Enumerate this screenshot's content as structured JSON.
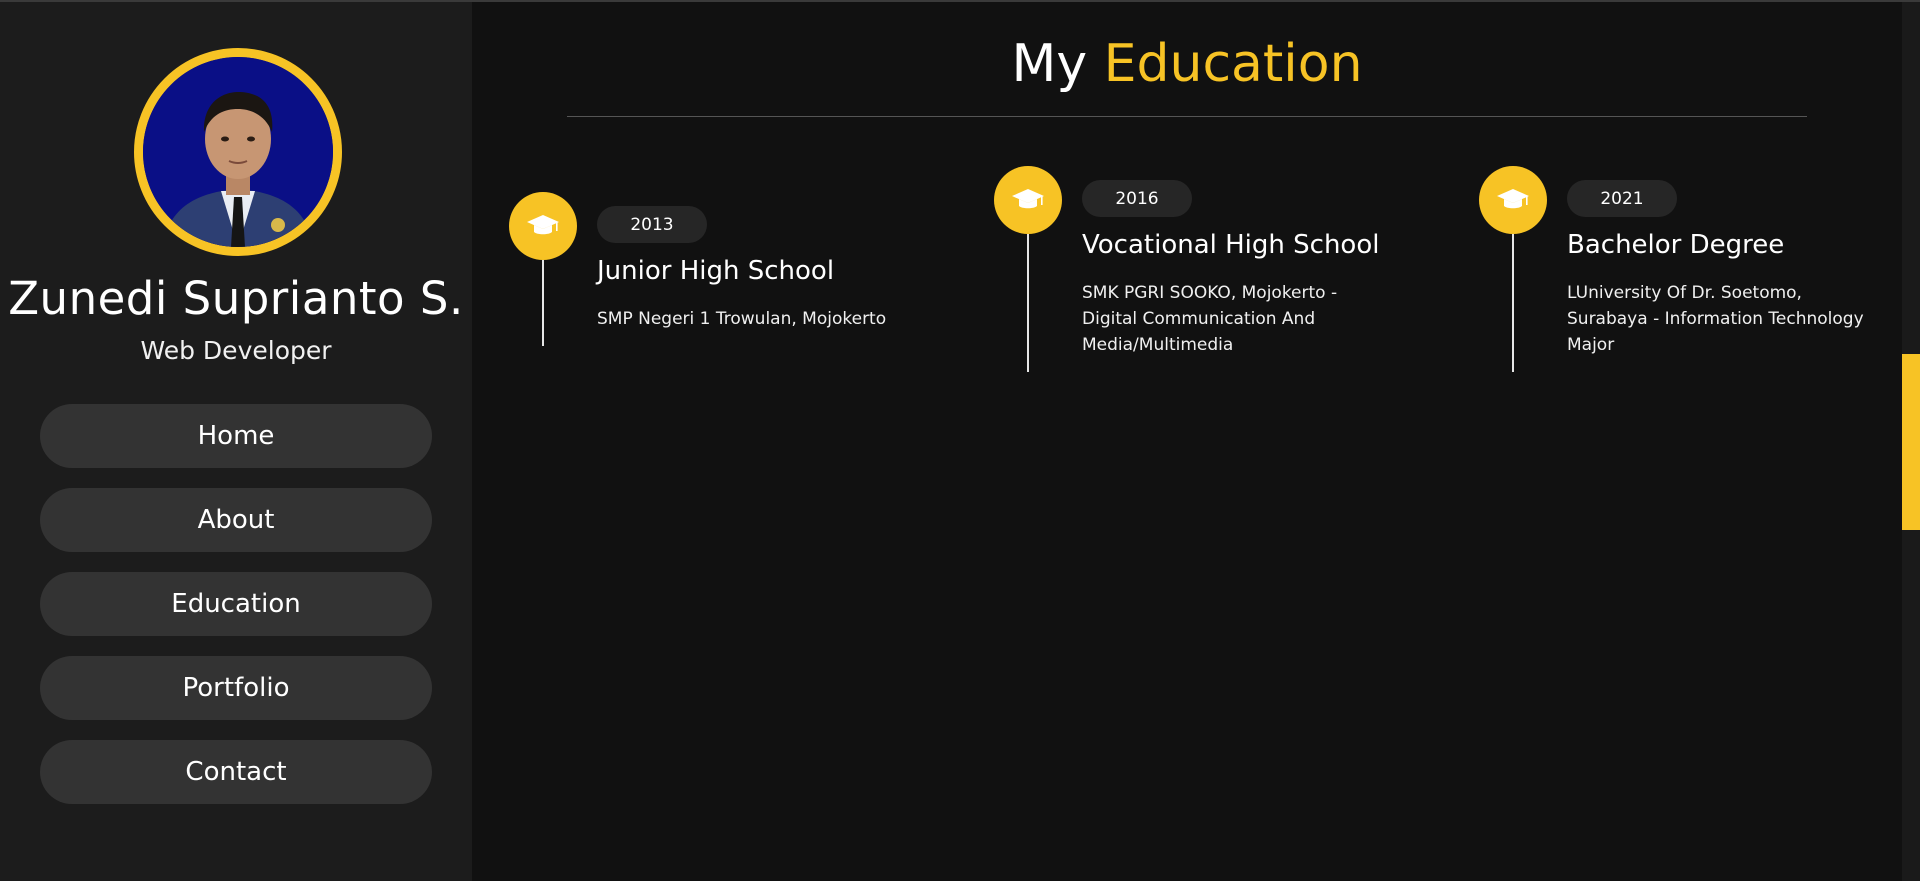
{
  "profile": {
    "name": "Zunedi Suprianto S.",
    "role": "Web Developer"
  },
  "nav": [
    {
      "label": "Home"
    },
    {
      "label": "About"
    },
    {
      "label": "Education"
    },
    {
      "label": "Portfolio"
    },
    {
      "label": "Contact"
    }
  ],
  "page": {
    "title_prefix": "My",
    "title_accent": "Education"
  },
  "education": [
    {
      "year": "2013",
      "title": "Junior High School",
      "description": "SMP Negeri 1 Trowulan, Mojokerto",
      "icon": "graduation-cap-icon"
    },
    {
      "year": "2016",
      "title": "Vocational High School",
      "description": "SMK PGRI SOOKO, Mojokerto - Digital Communication And Media/Multimedia",
      "icon": "graduation-cap-icon"
    },
    {
      "year": "2021",
      "title": "Bachelor Degree",
      "description": "LUniversity Of Dr. Soetomo, Surabaya - Information Technology Major",
      "icon": "graduation-cap-icon"
    }
  ],
  "colors": {
    "accent": "#f7c325",
    "background": "#111111",
    "sidebar": "#1c1c1c",
    "button": "#333333"
  }
}
